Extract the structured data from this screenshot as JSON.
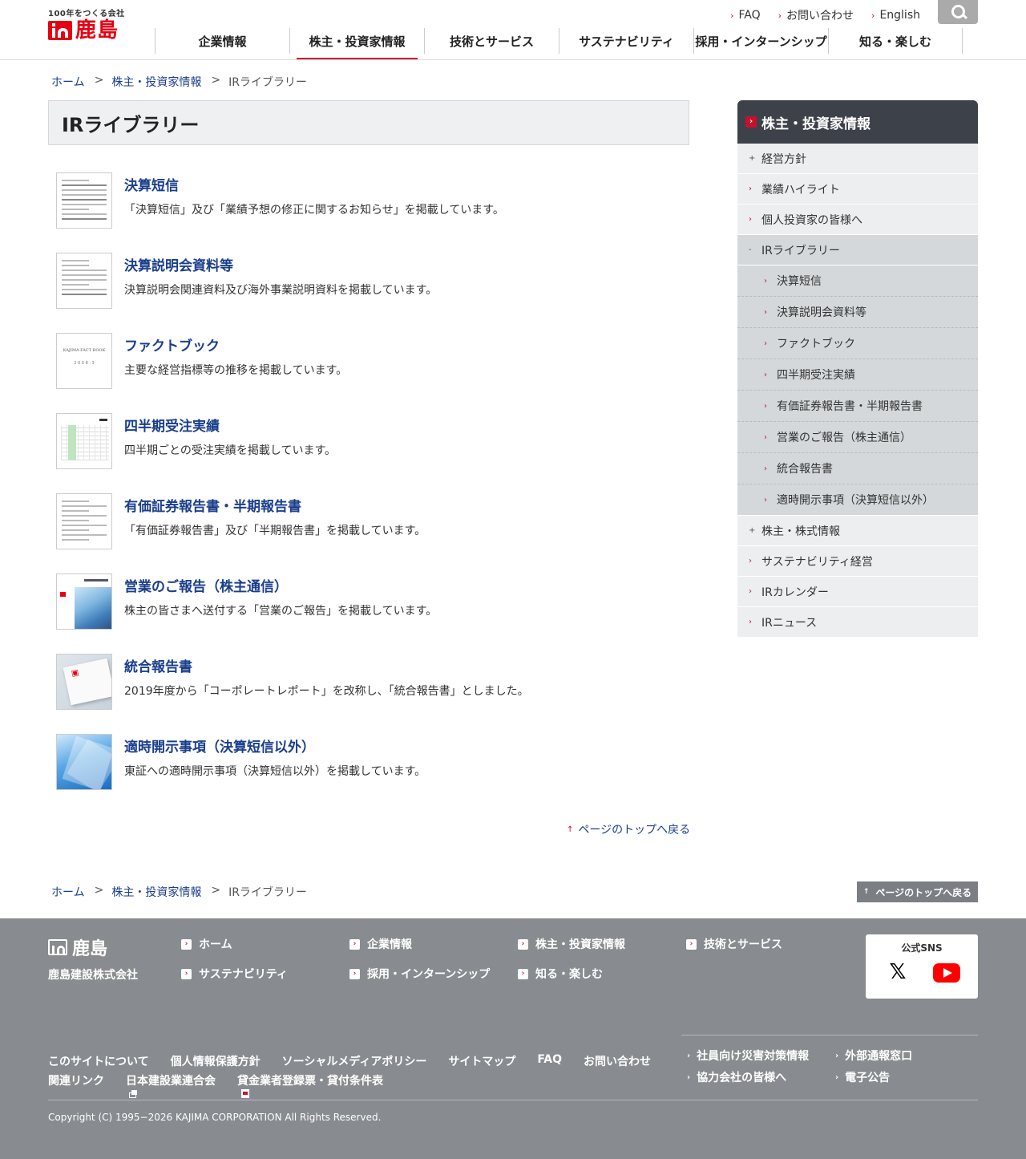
{
  "header": {
    "logo_tagline": "100年をつくる会社",
    "logo_text": "鹿島",
    "utility": [
      {
        "label": "FAQ"
      },
      {
        "label": "お問い合わせ"
      },
      {
        "label": "English"
      }
    ],
    "gnav": [
      {
        "label": "企業情報"
      },
      {
        "label": "株主・投資家情報"
      },
      {
        "label": "技術とサービス"
      },
      {
        "label": "サステナビリティ"
      },
      {
        "label": "採用・インターンシップ"
      },
      {
        "label": "知る・楽しむ"
      }
    ]
  },
  "breadcrumb": {
    "home": "ホーム",
    "parent": "株主・投資家情報",
    "current": "IRライブラリー",
    "separator": ">"
  },
  "page_title": "IRライブラリー",
  "library": [
    {
      "title": "決算短信",
      "desc": "「決算短信」及び「業績予想の修正に関するお知らせ」を掲載しています。"
    },
    {
      "title": "決算説明会資料等",
      "desc": "決算説明会関連資料及び海外事業説明資料を掲載しています。"
    },
    {
      "title": "ファクトブック",
      "desc": "主要な経営指標等の推移を掲載しています。"
    },
    {
      "title": "四半期受注実績",
      "desc": "四半期ごとの受注実績を掲載しています。"
    },
    {
      "title": "有価証券報告書・半期報告書",
      "desc": "「有価証券報告書」及び「半期報告書」を掲載しています。"
    },
    {
      "title": "営業のご報告（株主通信）",
      "desc": "株主の皆さまへ送付する「営業のご報告」を掲載しています。"
    },
    {
      "title": "統合報告書",
      "desc": "2019年度から「コーポレートレポート」を改称し、「統合報告書」としました。"
    },
    {
      "title": "適時開示事項（決算短信以外）",
      "desc": "東証への適時開示事項（決算短信以外）を掲載しています。"
    }
  ],
  "thumbs": {
    "fact_caption": "KAJIMA FACT BOOK",
    "fact_year": "2 0 0 8 . 3"
  },
  "page_top_link": "ページのトップへ戻る",
  "page_top_button": "ページのトップへ戻る",
  "side": {
    "heading": "株主・投資家情報",
    "items": [
      {
        "label": "経営方針"
      },
      {
        "label": "業績ハイライト"
      },
      {
        "label": "個人投資家の皆様へ"
      },
      {
        "label": "IRライブラリー"
      }
    ],
    "sub_items": [
      {
        "label": "決算短信"
      },
      {
        "label": "決算説明会資料等"
      },
      {
        "label": "ファクトブック"
      },
      {
        "label": "四半期受注実績"
      },
      {
        "label": "有価証券報告書・半期報告書"
      },
      {
        "label": "営業のご報告（株主通信）"
      },
      {
        "label": "統合報告書"
      },
      {
        "label": "適時開示事項（決算短信以外）"
      }
    ],
    "after_items": [
      {
        "label": "株主・株式情報"
      },
      {
        "label": "サステナビリティ経営"
      },
      {
        "label": "IRカレンダー"
      },
      {
        "label": "IRニュース"
      }
    ]
  },
  "footer": {
    "logo_text": "鹿島",
    "company": "鹿島建設株式会社",
    "nav": [
      {
        "label": "ホーム"
      },
      {
        "label": "企業情報"
      },
      {
        "label": "株主・投資家情報"
      },
      {
        "label": "技術とサービス"
      },
      {
        "label": "サステナビリティ"
      },
      {
        "label": "採用・インターンシップ"
      },
      {
        "label": "知る・楽しむ"
      }
    ],
    "sns_label": "公式SNS",
    "x_glyph": "𝕏",
    "links_row1": [
      {
        "label": "このサイトについて"
      },
      {
        "label": "個人情報保護方針"
      },
      {
        "label": "ソーシャルメディアポリシー"
      },
      {
        "label": "サイトマップ"
      },
      {
        "label": "FAQ"
      },
      {
        "label": "お問い合わせ"
      }
    ],
    "links_row2": [
      {
        "label": "関連リンク"
      },
      {
        "label": "日本建設業連合会"
      },
      {
        "label": "貸金業者登録票・貸付条件表"
      }
    ],
    "right_links": [
      {
        "label": "社員向け災害対策情報"
      },
      {
        "label": "外部通報窓口"
      },
      {
        "label": "協力会社の皆様へ"
      },
      {
        "label": "電子公告"
      }
    ],
    "copyright": "Copyright (C) 1995−2026 KAJIMA CORPORATION All Rights Reserved."
  }
}
